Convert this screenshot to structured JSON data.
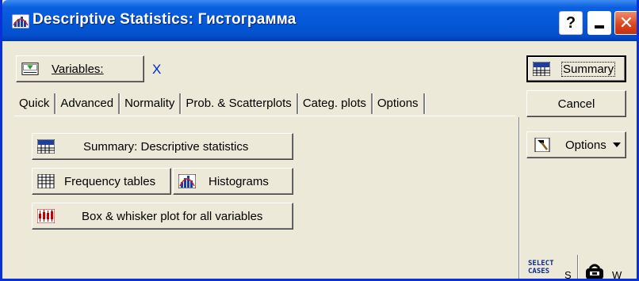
{
  "window": {
    "title": "Descriptive Statistics: Гистограмма",
    "help_label": "?",
    "close_label": "✕"
  },
  "variables": {
    "button_label": "Variables:",
    "value": "X"
  },
  "tabs": [
    {
      "label": "Quick",
      "active": true
    },
    {
      "label": "Advanced"
    },
    {
      "label": "Normality"
    },
    {
      "label": "Prob. & Scatterplots"
    },
    {
      "label": "Categ. plots"
    },
    {
      "label": "Options"
    }
  ],
  "quick": {
    "summary_desc_label": "Summary: Descriptive statistics",
    "frequency_label": "Frequency tables",
    "histograms_label": "Histograms",
    "box_label": "Box & whisker plot for all variables"
  },
  "side": {
    "summary_label": "Summary",
    "cancel_label": "Cancel",
    "options_label": "Options",
    "select_cases_line1": "SELECT",
    "select_cases_line2": "CASES",
    "s_label": "S",
    "w_label": "W"
  },
  "colors": {
    "title_bar": "#0558d8",
    "dialog_bg": "#ece9d8",
    "variable_value": "#0028d0",
    "close_button": "#d9431c"
  }
}
